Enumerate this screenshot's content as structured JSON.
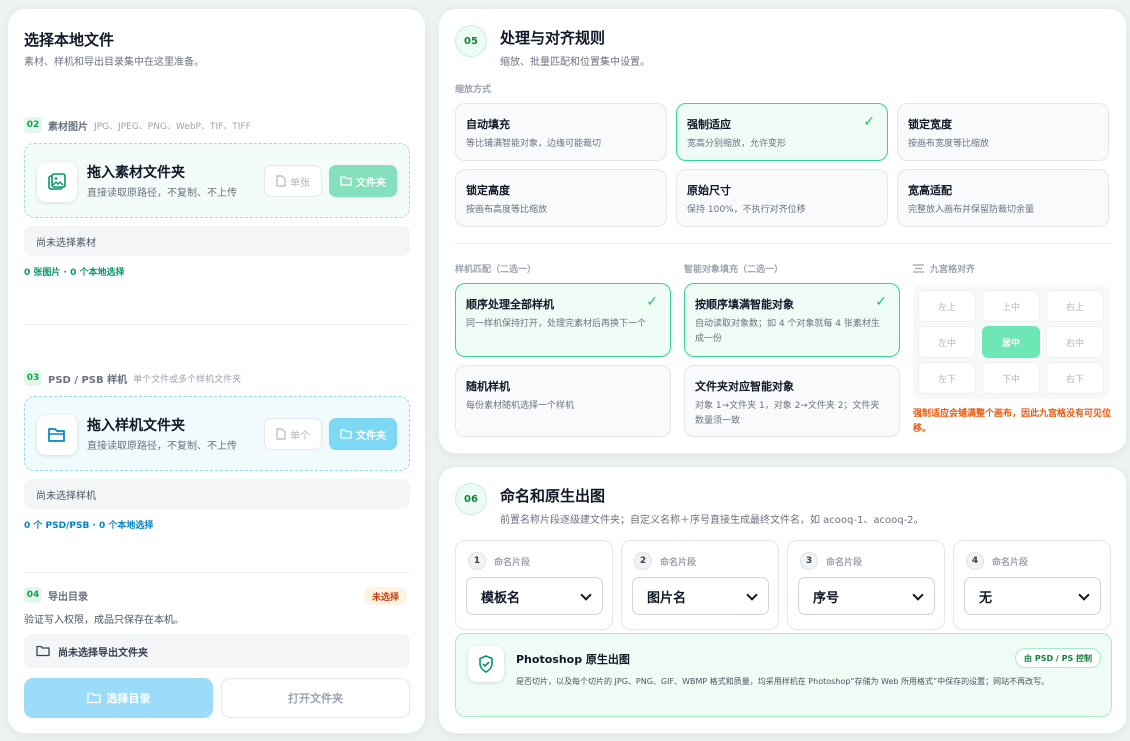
{
  "left": {
    "title": "选择本地文件",
    "subtitle": "素材、样机和导出目录集中在这里准备。",
    "materials": {
      "step": "02",
      "label": "素材图片",
      "formats": "JPG、JPEG、PNG、WebP、TIF、TIFF",
      "drop_title": "拖入素材文件夹",
      "drop_sub": "直接读取原路径，不复制、不上传",
      "single_label": "单张",
      "folder_label": "文件夹",
      "status": "尚未选择素材",
      "count": "0 张图片 · 0 个本地选择"
    },
    "mockups": {
      "step": "03",
      "label": "PSD / PSB 样机",
      "note": "单个文件或多个样机文件夹",
      "drop_title": "拖入样机文件夹",
      "drop_sub": "直接读取原路径，不复制、不上传",
      "single_label": "单个",
      "folder_label": "文件夹",
      "status": "尚未选择样机",
      "count": "0 个 PSD/PSB · 0 个本地选择"
    },
    "export": {
      "step": "04",
      "label": "导出目录",
      "badge": "未选择",
      "desc": "验证写入权限，成品只保存在本机。",
      "status": "尚未选择导出文件夹",
      "choose_label": "选择目录",
      "open_label": "打开文件夹"
    }
  },
  "rules": {
    "step": "05",
    "title": "处理与对齐规则",
    "subtitle": "缩放、批量匹配和位置集中设置。",
    "scale_label": "缩放方式",
    "scale_modes": [
      {
        "title": "自动填充",
        "desc": "等比铺满智能对象，边缘可能裁切",
        "selected": false
      },
      {
        "title": "强制适应",
        "desc": "宽高分别缩放，允许变形",
        "selected": true
      },
      {
        "title": "锁定宽度",
        "desc": "按画布宽度等比缩放",
        "selected": false
      },
      {
        "title": "锁定高度",
        "desc": "按画布高度等比缩放",
        "selected": false
      },
      {
        "title": "原始尺寸",
        "desc": "保持 100%，不执行对齐位移",
        "selected": false
      },
      {
        "title": "宽高适配",
        "desc": "完整放入画布并保留防裁切余量",
        "selected": false
      }
    ],
    "mockup_match_label": "样机匹配（二选一）",
    "mockup_match": [
      {
        "title": "顺序处理全部样机",
        "desc": "同一样机保持打开，处理完素材后再换下一个",
        "selected": true
      },
      {
        "title": "随机样机",
        "desc": "每份素材随机选择一个样机",
        "selected": false
      }
    ],
    "smart_fill_label": "智能对象填充（二选一）",
    "smart_fill": [
      {
        "title": "按顺序填满智能对象",
        "desc": "自动读取对象数；如 4 个对象就每 4 张素材生成一份",
        "selected": true
      },
      {
        "title": "文件夹对应智能对象",
        "desc": "对象 1→文件夹 1，对象 2→文件夹 2；文件夹数量须一致",
        "selected": false
      }
    ],
    "align_label": "九宫格对齐",
    "align_cells": [
      "左上",
      "上中",
      "右上",
      "左中",
      "居中",
      "右中",
      "左下",
      "下中",
      "右下"
    ],
    "align_selected": "居中",
    "align_warning": "强制适应会铺满整个画布，因此九宫格没有可见位移。"
  },
  "naming": {
    "step": "06",
    "title": "命名和原生出图",
    "subtitle": "前置名称片段逐级建文件夹；自定义名称＋序号直接生成最终文件名，如 acooq-1、acooq-2。",
    "segment_label": "命名片段",
    "segments": [
      {
        "num": "1",
        "value": "模板名"
      },
      {
        "num": "2",
        "value": "图片名"
      },
      {
        "num": "3",
        "value": "序号"
      },
      {
        "num": "4",
        "value": "无"
      }
    ],
    "ps": {
      "title": "Photoshop 原生出图",
      "badge": "由 PSD / PS 控制",
      "desc": "是否切片，以及每个切片的 JPG、PNG、GIF、WBMP 格式和质量，均采用样机在 Photoshop“存储为 Web 所用格式”中保存的设置；网站不再改写。"
    }
  },
  "colors": {
    "accent_green": "#34d399",
    "accent_teal": "#7dd8f3",
    "count_green": "#059669",
    "count_blue": "#0284c7",
    "warning": "#ea580c"
  }
}
